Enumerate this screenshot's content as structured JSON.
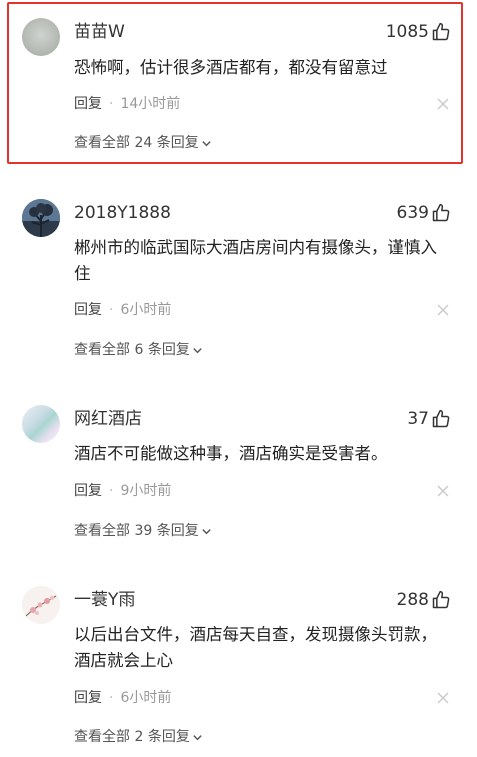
{
  "comments": [
    {
      "username": "苗苗W",
      "likes": "1085",
      "text": "恐怖啊，估计很多酒店都有，都没有留意过",
      "reply_label": "回复",
      "separator": "·",
      "time": "14小时前",
      "view_all_prefix": "查看全部",
      "reply_count": "24",
      "view_all_suffix": "条回复",
      "highlighted": true
    },
    {
      "username": "2018Y1888",
      "likes": "639",
      "text": "郴州市的临武国际大酒店房间内有摄像头，谨慎入住",
      "reply_label": "回复",
      "separator": "·",
      "time": "6小时前",
      "view_all_prefix": "查看全部",
      "reply_count": "6",
      "view_all_suffix": "条回复"
    },
    {
      "username": "网红酒店",
      "likes": "37",
      "text": "酒店不可能做这种事，酒店确实是受害者。",
      "reply_label": "回复",
      "separator": "·",
      "time": "9小时前",
      "view_all_prefix": "查看全部",
      "reply_count": "39",
      "view_all_suffix": "条回复"
    },
    {
      "username": "一蓑Y雨",
      "likes": "288",
      "text": "以后出台文件，酒店每天自查，发现摄像头罚款，酒店就会上心",
      "reply_label": "回复",
      "separator": "·",
      "time": "6小时前",
      "view_all_prefix": "查看全部",
      "reply_count": "2",
      "view_all_suffix": "条回复"
    }
  ],
  "colors": {
    "highlight_border": "#e0342d",
    "text_primary": "#222222",
    "text_secondary": "#999999"
  },
  "icons": {
    "like": "thumbs-up-icon",
    "close": "close-icon",
    "expand": "chevron-down-icon"
  }
}
